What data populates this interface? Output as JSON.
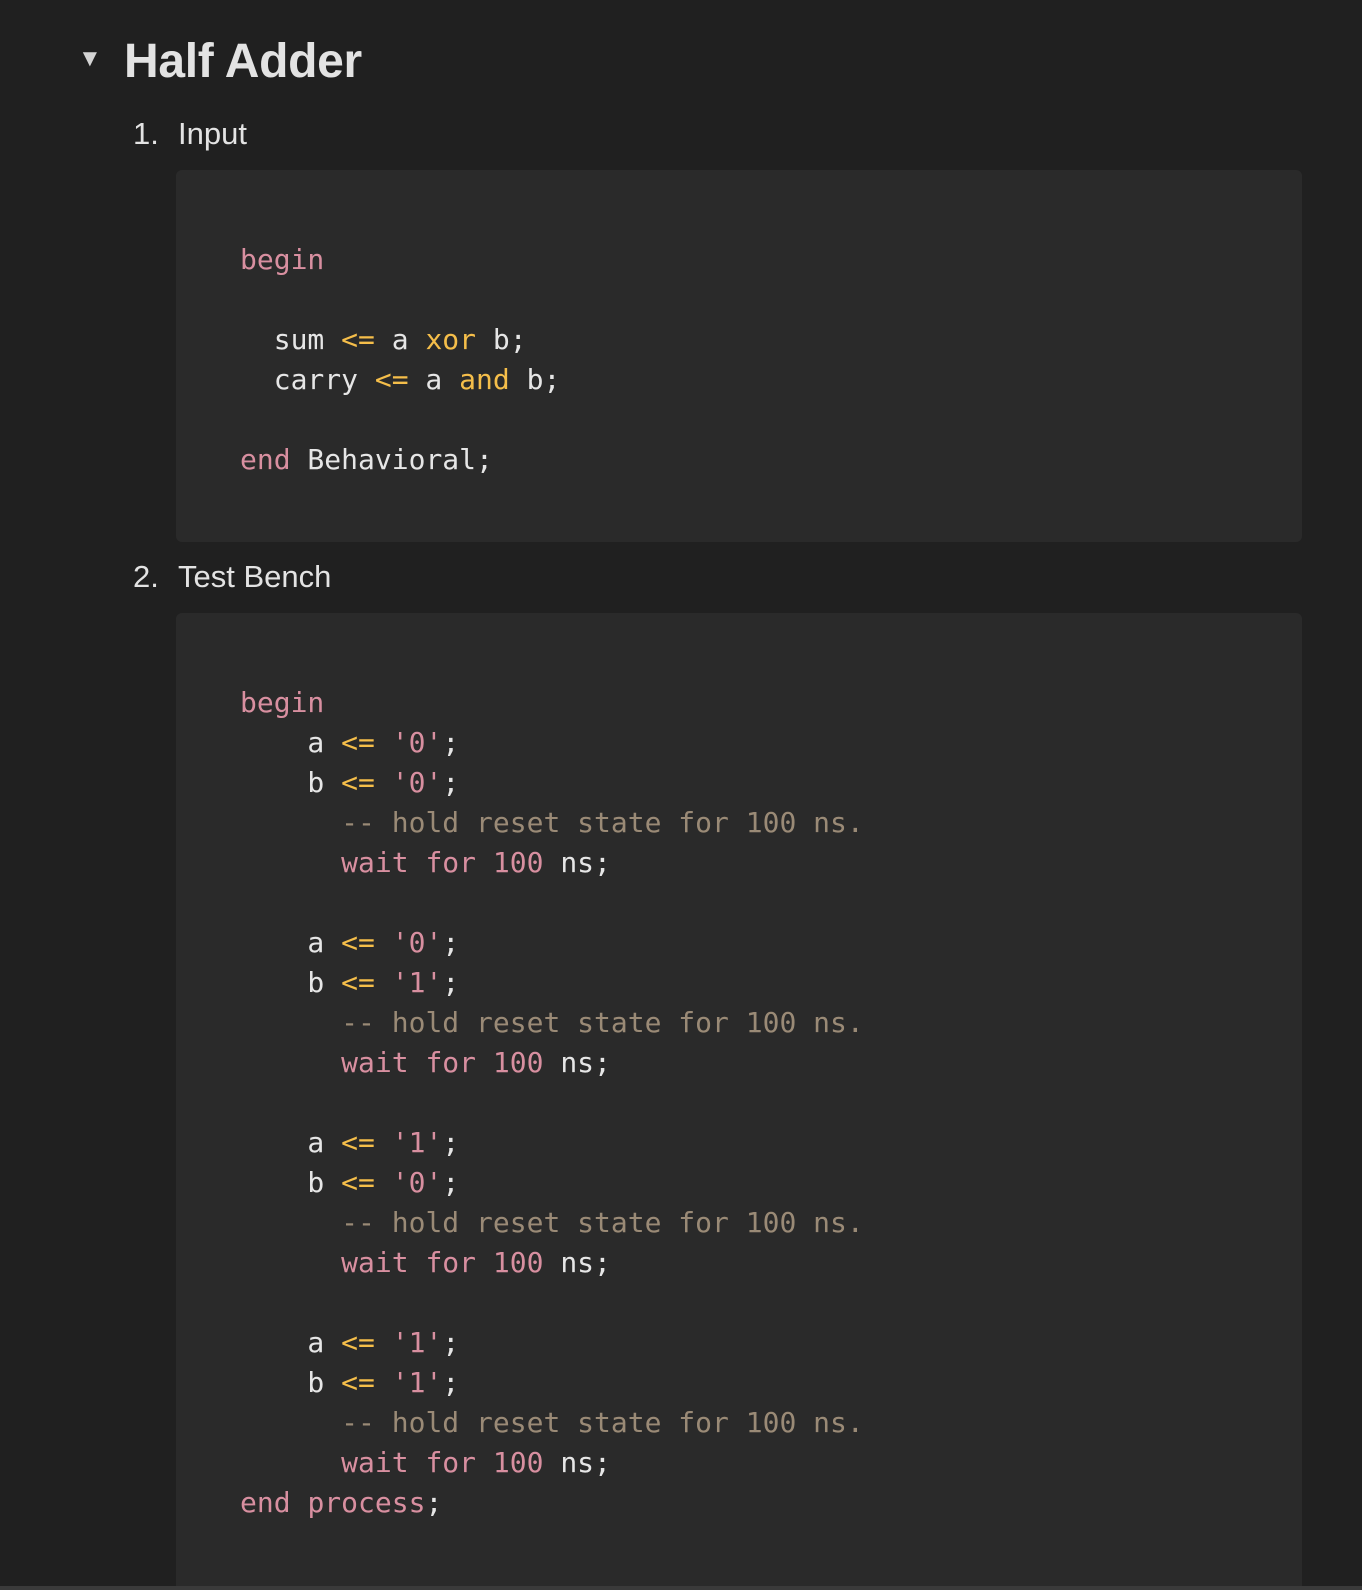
{
  "page": {
    "title": "Half Adder",
    "toggle_icon": "▼"
  },
  "sections": [
    {
      "number": "1.",
      "label": "Input",
      "code": [
        [],
        [
          [
            "kw",
            "begin"
          ]
        ],
        [],
        [
          [
            "id",
            "  sum "
          ],
          [
            "op",
            "<="
          ],
          [
            "id",
            " a "
          ],
          [
            "op",
            "xor"
          ],
          [
            "id",
            " b;"
          ]
        ],
        [
          [
            "id",
            "  carry "
          ],
          [
            "op",
            "<="
          ],
          [
            "id",
            " a "
          ],
          [
            "op",
            "and"
          ],
          [
            "id",
            " b;"
          ]
        ],
        [],
        [
          [
            "kw",
            "end"
          ],
          [
            "id",
            " Behavioral;"
          ]
        ]
      ]
    },
    {
      "number": "2.",
      "label": "Test Bench",
      "code": [
        [],
        [
          [
            "kw",
            "begin"
          ]
        ],
        [
          [
            "id",
            "    a "
          ],
          [
            "op",
            "<="
          ],
          [
            "id",
            " "
          ],
          [
            "str",
            "'0'"
          ],
          [
            "id",
            ";"
          ]
        ],
        [
          [
            "id",
            "    b "
          ],
          [
            "op",
            "<="
          ],
          [
            "id",
            " "
          ],
          [
            "str",
            "'0'"
          ],
          [
            "id",
            ";"
          ]
        ],
        [
          [
            "id",
            "      "
          ],
          [
            "cm",
            "-- hold reset state for 100 ns."
          ]
        ],
        [
          [
            "id",
            "      "
          ],
          [
            "kw",
            "wait"
          ],
          [
            "id",
            " "
          ],
          [
            "kw",
            "for"
          ],
          [
            "id",
            " "
          ],
          [
            "num",
            "100"
          ],
          [
            "id",
            " ns;"
          ]
        ],
        [],
        [
          [
            "id",
            "    a "
          ],
          [
            "op",
            "<="
          ],
          [
            "id",
            " "
          ],
          [
            "str",
            "'0'"
          ],
          [
            "id",
            ";"
          ]
        ],
        [
          [
            "id",
            "    b "
          ],
          [
            "op",
            "<="
          ],
          [
            "id",
            " "
          ],
          [
            "str",
            "'1'"
          ],
          [
            "id",
            ";"
          ]
        ],
        [
          [
            "id",
            "      "
          ],
          [
            "cm",
            "-- hold reset state for 100 ns."
          ]
        ],
        [
          [
            "id",
            "      "
          ],
          [
            "kw",
            "wait"
          ],
          [
            "id",
            " "
          ],
          [
            "kw",
            "for"
          ],
          [
            "id",
            " "
          ],
          [
            "num",
            "100"
          ],
          [
            "id",
            " ns;"
          ]
        ],
        [],
        [
          [
            "id",
            "    a "
          ],
          [
            "op",
            "<="
          ],
          [
            "id",
            " "
          ],
          [
            "str",
            "'1'"
          ],
          [
            "id",
            ";"
          ]
        ],
        [
          [
            "id",
            "    b "
          ],
          [
            "op",
            "<="
          ],
          [
            "id",
            " "
          ],
          [
            "str",
            "'0'"
          ],
          [
            "id",
            ";"
          ]
        ],
        [
          [
            "id",
            "      "
          ],
          [
            "cm",
            "-- hold reset state for 100 ns."
          ]
        ],
        [
          [
            "id",
            "      "
          ],
          [
            "kw",
            "wait"
          ],
          [
            "id",
            " "
          ],
          [
            "kw",
            "for"
          ],
          [
            "id",
            " "
          ],
          [
            "num",
            "100"
          ],
          [
            "id",
            " ns;"
          ]
        ],
        [],
        [
          [
            "id",
            "    a "
          ],
          [
            "op",
            "<="
          ],
          [
            "id",
            " "
          ],
          [
            "str",
            "'1'"
          ],
          [
            "id",
            ";"
          ]
        ],
        [
          [
            "id",
            "    b "
          ],
          [
            "op",
            "<="
          ],
          [
            "id",
            " "
          ],
          [
            "str",
            "'1'"
          ],
          [
            "id",
            ";"
          ]
        ],
        [
          [
            "id",
            "      "
          ],
          [
            "cm",
            "-- hold reset state for 100 ns."
          ]
        ],
        [
          [
            "id",
            "      "
          ],
          [
            "kw",
            "wait"
          ],
          [
            "id",
            " "
          ],
          [
            "kw",
            "for"
          ],
          [
            "id",
            " "
          ],
          [
            "num",
            "100"
          ],
          [
            "id",
            " ns;"
          ]
        ],
        [
          [
            "kw",
            "end"
          ],
          [
            "id",
            " "
          ],
          [
            "kw",
            "process"
          ],
          [
            "id",
            ";"
          ]
        ]
      ]
    }
  ]
}
